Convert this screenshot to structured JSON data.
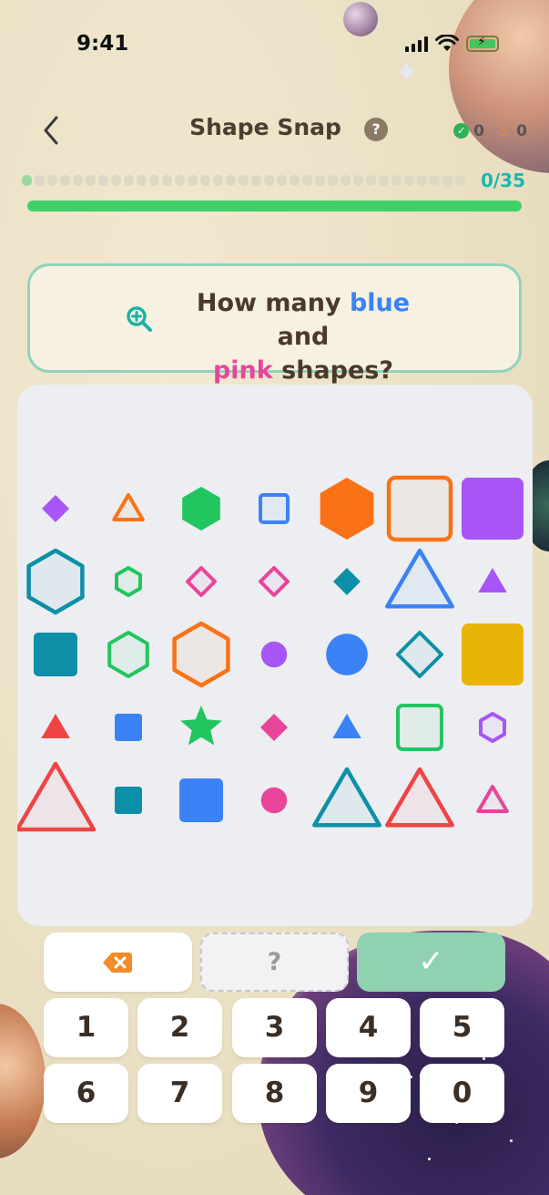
{
  "status_bar": {
    "time": "9:41"
  },
  "header": {
    "title": "Shape Snap",
    "help_label": "?",
    "correct_count": "0",
    "streak_count": "0"
  },
  "progress": {
    "counter": "0/35",
    "current": 0,
    "total": 35
  },
  "question": {
    "prefix": "How many ",
    "color1": "blue",
    "middle": " and",
    "color2": "pink",
    "suffix": " shapes?"
  },
  "keypad": {
    "unknown_label": "?",
    "submit_label": "✓",
    "digits": [
      "1",
      "2",
      "3",
      "4",
      "5",
      "6",
      "7",
      "8",
      "9",
      "0"
    ]
  },
  "colors": {
    "blue": "#3b82f6",
    "pink": "#e8459a",
    "teal": "#0e8fa8",
    "green": "#22c55e",
    "orange": "#f97316",
    "purple": "#a855f7",
    "red": "#ef4444",
    "yellow": "#eab308"
  },
  "shapes": [
    {
      "shape": "diamond",
      "style": "fill",
      "color": "purple",
      "size": "small"
    },
    {
      "shape": "triangle",
      "style": "outline",
      "color": "orange",
      "size": "small"
    },
    {
      "shape": "hexagon",
      "style": "fill",
      "color": "green",
      "size": "medium"
    },
    {
      "shape": "square",
      "style": "outline",
      "color": "blue",
      "size": "small"
    },
    {
      "shape": "hexagon",
      "style": "fill",
      "color": "orange",
      "size": "large"
    },
    {
      "shape": "square",
      "style": "outline",
      "color": "orange",
      "size": "large"
    },
    {
      "shape": "square",
      "style": "fill",
      "color": "purple",
      "size": "large"
    },
    {
      "shape": "hexagon",
      "style": "outline",
      "color": "teal",
      "size": "large"
    },
    {
      "shape": "hexagon",
      "style": "outline",
      "color": "green",
      "size": "small"
    },
    {
      "shape": "diamond",
      "style": "outline",
      "color": "pink",
      "size": "small"
    },
    {
      "shape": "diamond",
      "style": "outline",
      "color": "pink",
      "size": "small"
    },
    {
      "shape": "diamond",
      "style": "fill",
      "color": "teal",
      "size": "small"
    },
    {
      "shape": "triangle",
      "style": "outline",
      "color": "blue",
      "size": "large"
    },
    {
      "shape": "triangle",
      "style": "fill",
      "color": "purple",
      "size": "small"
    },
    {
      "shape": "square",
      "style": "fill",
      "color": "teal",
      "size": "medium"
    },
    {
      "shape": "hexagon",
      "style": "outline",
      "color": "green",
      "size": "medium"
    },
    {
      "shape": "hexagon",
      "style": "outline",
      "color": "orange",
      "size": "large"
    },
    {
      "shape": "circle",
      "style": "fill",
      "color": "purple",
      "size": "small"
    },
    {
      "shape": "circle",
      "style": "fill",
      "color": "blue",
      "size": "medium"
    },
    {
      "shape": "diamond",
      "style": "outline",
      "color": "teal",
      "size": "medium"
    },
    {
      "shape": "square",
      "style": "fill",
      "color": "yellow",
      "size": "large"
    },
    {
      "shape": "triangle",
      "style": "fill",
      "color": "red",
      "size": "small"
    },
    {
      "shape": "square",
      "style": "fill",
      "color": "blue",
      "size": "small"
    },
    {
      "shape": "star",
      "style": "fill",
      "color": "green",
      "size": "medium"
    },
    {
      "shape": "diamond",
      "style": "fill",
      "color": "pink",
      "size": "small"
    },
    {
      "shape": "triangle",
      "style": "fill",
      "color": "blue",
      "size": "small"
    },
    {
      "shape": "square",
      "style": "outline",
      "color": "green",
      "size": "medium"
    },
    {
      "shape": "hexagon",
      "style": "outline",
      "color": "purple",
      "size": "small"
    },
    {
      "shape": "triangle",
      "style": "outline",
      "color": "red",
      "size": "xlarge"
    },
    {
      "shape": "square",
      "style": "fill",
      "color": "teal",
      "size": "small"
    },
    {
      "shape": "square",
      "style": "fill",
      "color": "blue",
      "size": "medium"
    },
    {
      "shape": "circle",
      "style": "fill",
      "color": "pink",
      "size": "small"
    },
    {
      "shape": "triangle",
      "style": "outline",
      "color": "teal",
      "size": "large"
    },
    {
      "shape": "triangle",
      "style": "outline",
      "color": "red",
      "size": "large"
    },
    {
      "shape": "triangle",
      "style": "outline",
      "color": "pink",
      "size": "small"
    }
  ]
}
